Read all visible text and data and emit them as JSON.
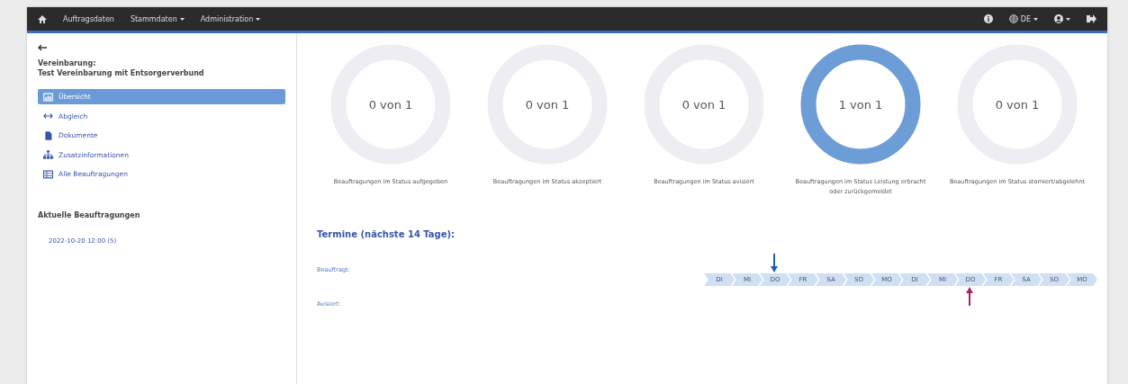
{
  "navbar": {
    "items": [
      {
        "label": "Auftragsdaten",
        "dropdown": false
      },
      {
        "label": "Stammdaten",
        "dropdown": true
      },
      {
        "label": "Administration",
        "dropdown": true
      }
    ],
    "language": "DE"
  },
  "sidebar": {
    "agreement_label": "Vereinbarung:",
    "agreement_name": "Test Vereinbarung mit Entsorgerverbund",
    "items": [
      {
        "label": "Übersicht",
        "kind": "chart",
        "selected": true
      },
      {
        "label": "Abgleich",
        "kind": "compare",
        "selected": false
      },
      {
        "label": "Dokumente",
        "kind": "document",
        "selected": false
      },
      {
        "label": "Zusatzinformationen",
        "kind": "sitemap",
        "selected": false
      },
      {
        "label": "Alle Beauftragungen",
        "kind": "table",
        "selected": false
      }
    ],
    "current_title": "Aktuelle Beauftragungen",
    "current_items": [
      "2022-10-20 12:00 (5)"
    ]
  },
  "gauges": [
    {
      "value": "0 von 1",
      "level": 0,
      "caption": "Beauftragungen im Status aufgegeben"
    },
    {
      "value": "0 von 1",
      "level": 0,
      "caption": "Beauftragungen im Status akzeptiert"
    },
    {
      "value": "0 von 1",
      "level": 0,
      "caption": "Beauftragungen im Status avisiert"
    },
    {
      "value": "1 von 1",
      "level": 1,
      "caption": "Beauftragungen im Status Leistung erbracht oder zurückgemeldet"
    },
    {
      "value": "0 von 1",
      "level": 0,
      "caption": "Beauftragungen im Status storniert/abgelehnt"
    }
  ],
  "schedule": {
    "title": "Termine (nächste 14 Tage):",
    "row_labels": [
      "Beauftragt:",
      "Avisiert:"
    ],
    "days": [
      {
        "label": "DI",
        "beauftragt": false,
        "avisiert": false
      },
      {
        "label": "MI",
        "beauftragt": false,
        "avisiert": false
      },
      {
        "label": "DO",
        "beauftragt": true,
        "avisiert": false
      },
      {
        "label": "FR",
        "beauftragt": false,
        "avisiert": false
      },
      {
        "label": "SA",
        "beauftragt": false,
        "avisiert": false
      },
      {
        "label": "SO",
        "beauftragt": false,
        "avisiert": false
      },
      {
        "label": "MO",
        "beauftragt": false,
        "avisiert": false
      },
      {
        "label": "DI",
        "beauftragt": false,
        "avisiert": false
      },
      {
        "label": "MI",
        "beauftragt": false,
        "avisiert": false
      },
      {
        "label": "DO",
        "beauftragt": false,
        "avisiert": true
      },
      {
        "label": "FR",
        "beauftragt": false,
        "avisiert": false
      },
      {
        "label": "SA",
        "beauftragt": false,
        "avisiert": false
      },
      {
        "label": "SO",
        "beauftragt": false,
        "avisiert": false
      },
      {
        "label": "MO",
        "beauftragt": false,
        "avisiert": false
      }
    ]
  }
}
